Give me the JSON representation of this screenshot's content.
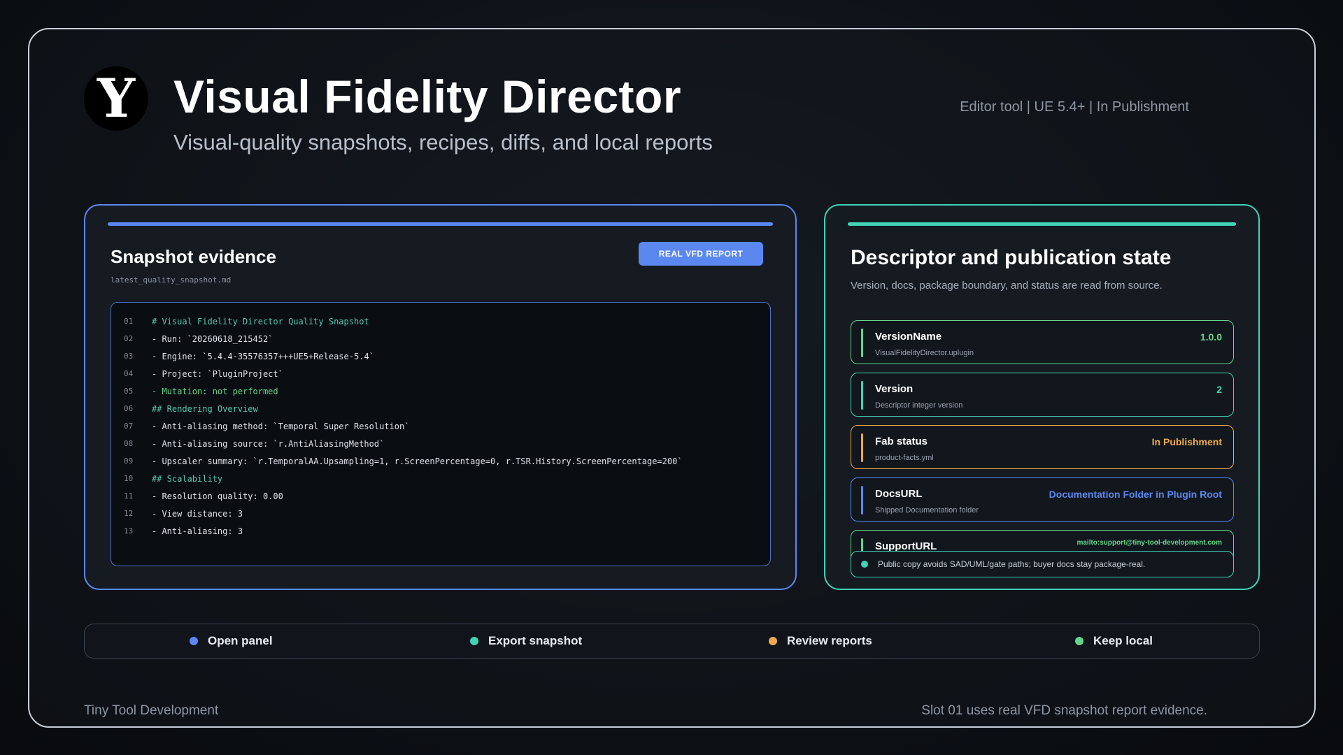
{
  "header": {
    "logo_letter": "Y",
    "title": "Visual Fidelity Director",
    "subtitle": "Visual-quality snapshots, recipes, diffs, and local reports",
    "meta": "Editor tool  |  UE 5.4+  |  In Publishment"
  },
  "snapshot_panel": {
    "title": "Snapshot evidence",
    "filename": "latest_quality_snapshot.md",
    "badge_label": "REAL VFD REPORT",
    "lines": [
      {
        "num": "01",
        "text": "# Visual Fidelity Director Quality Snapshot",
        "style": "heading"
      },
      {
        "num": "02",
        "text": "- Run: `20260618_215452`",
        "style": "plain"
      },
      {
        "num": "03",
        "text": "- Engine: `5.4.4-35576357+++UE5+Release-5.4`",
        "style": "plain"
      },
      {
        "num": "04",
        "text": "- Project: `PluginProject`",
        "style": "plain"
      },
      {
        "num": "05",
        "text": "- Mutation: not performed",
        "style": "green"
      },
      {
        "num": "06",
        "text": "## Rendering Overview",
        "style": "heading"
      },
      {
        "num": "07",
        "text": "- Anti-aliasing method: `Temporal Super Resolution`",
        "style": "plain"
      },
      {
        "num": "08",
        "text": "- Anti-aliasing source: `r.AntiAliasingMethod`",
        "style": "plain"
      },
      {
        "num": "09",
        "text": "- Upscaler summary: `r.TemporalAA.Upsampling=1, r.ScreenPercentage=0, r.TSR.History.ScreenPercentage=200`",
        "style": "plain"
      },
      {
        "num": "10",
        "text": "## Scalability",
        "style": "heading"
      },
      {
        "num": "11",
        "text": "- Resolution quality: 0.00",
        "style": "plain"
      },
      {
        "num": "12",
        "text": "- View distance: 3",
        "style": "plain"
      },
      {
        "num": "13",
        "text": "- Anti-aliasing: 3",
        "style": "plain"
      }
    ]
  },
  "descriptor_panel": {
    "title": "Descriptor and publication state",
    "description": "Version, docs, package boundary, and status are read from source.",
    "cards": [
      {
        "name": "VersionName",
        "sub": "VisualFidelityDirector.uplugin",
        "value": "1.0.0",
        "color": "#64d68a"
      },
      {
        "name": "Version",
        "sub": "Descriptor integer version",
        "value": "2",
        "color": "#3fd4b5"
      },
      {
        "name": "Fab status",
        "sub": "product-facts.yml",
        "value": "In Publishment",
        "color": "#f0a94a"
      },
      {
        "name": "DocsURL",
        "sub": "Shipped Documentation folder",
        "value": "Documentation Folder in Plugin Root",
        "color": "#5b88f0"
      },
      {
        "name": "SupportURL",
        "sub": "",
        "value": "mailto:support@tiny-tool-development.com",
        "color": "#64d68a"
      }
    ],
    "note": "Public copy avoids SAD/UML/gate paths; buyer docs stay package-real."
  },
  "actions": [
    {
      "label": "Open panel",
      "color": "#5b88f0"
    },
    {
      "label": "Export snapshot",
      "color": "#3fd4b5"
    },
    {
      "label": "Review reports",
      "color": "#f0a94a"
    },
    {
      "label": "Keep local",
      "color": "#64d68a"
    }
  ],
  "footer": {
    "left": "Tiny Tool Development",
    "right": "Slot 01 uses real VFD snapshot report evidence."
  }
}
